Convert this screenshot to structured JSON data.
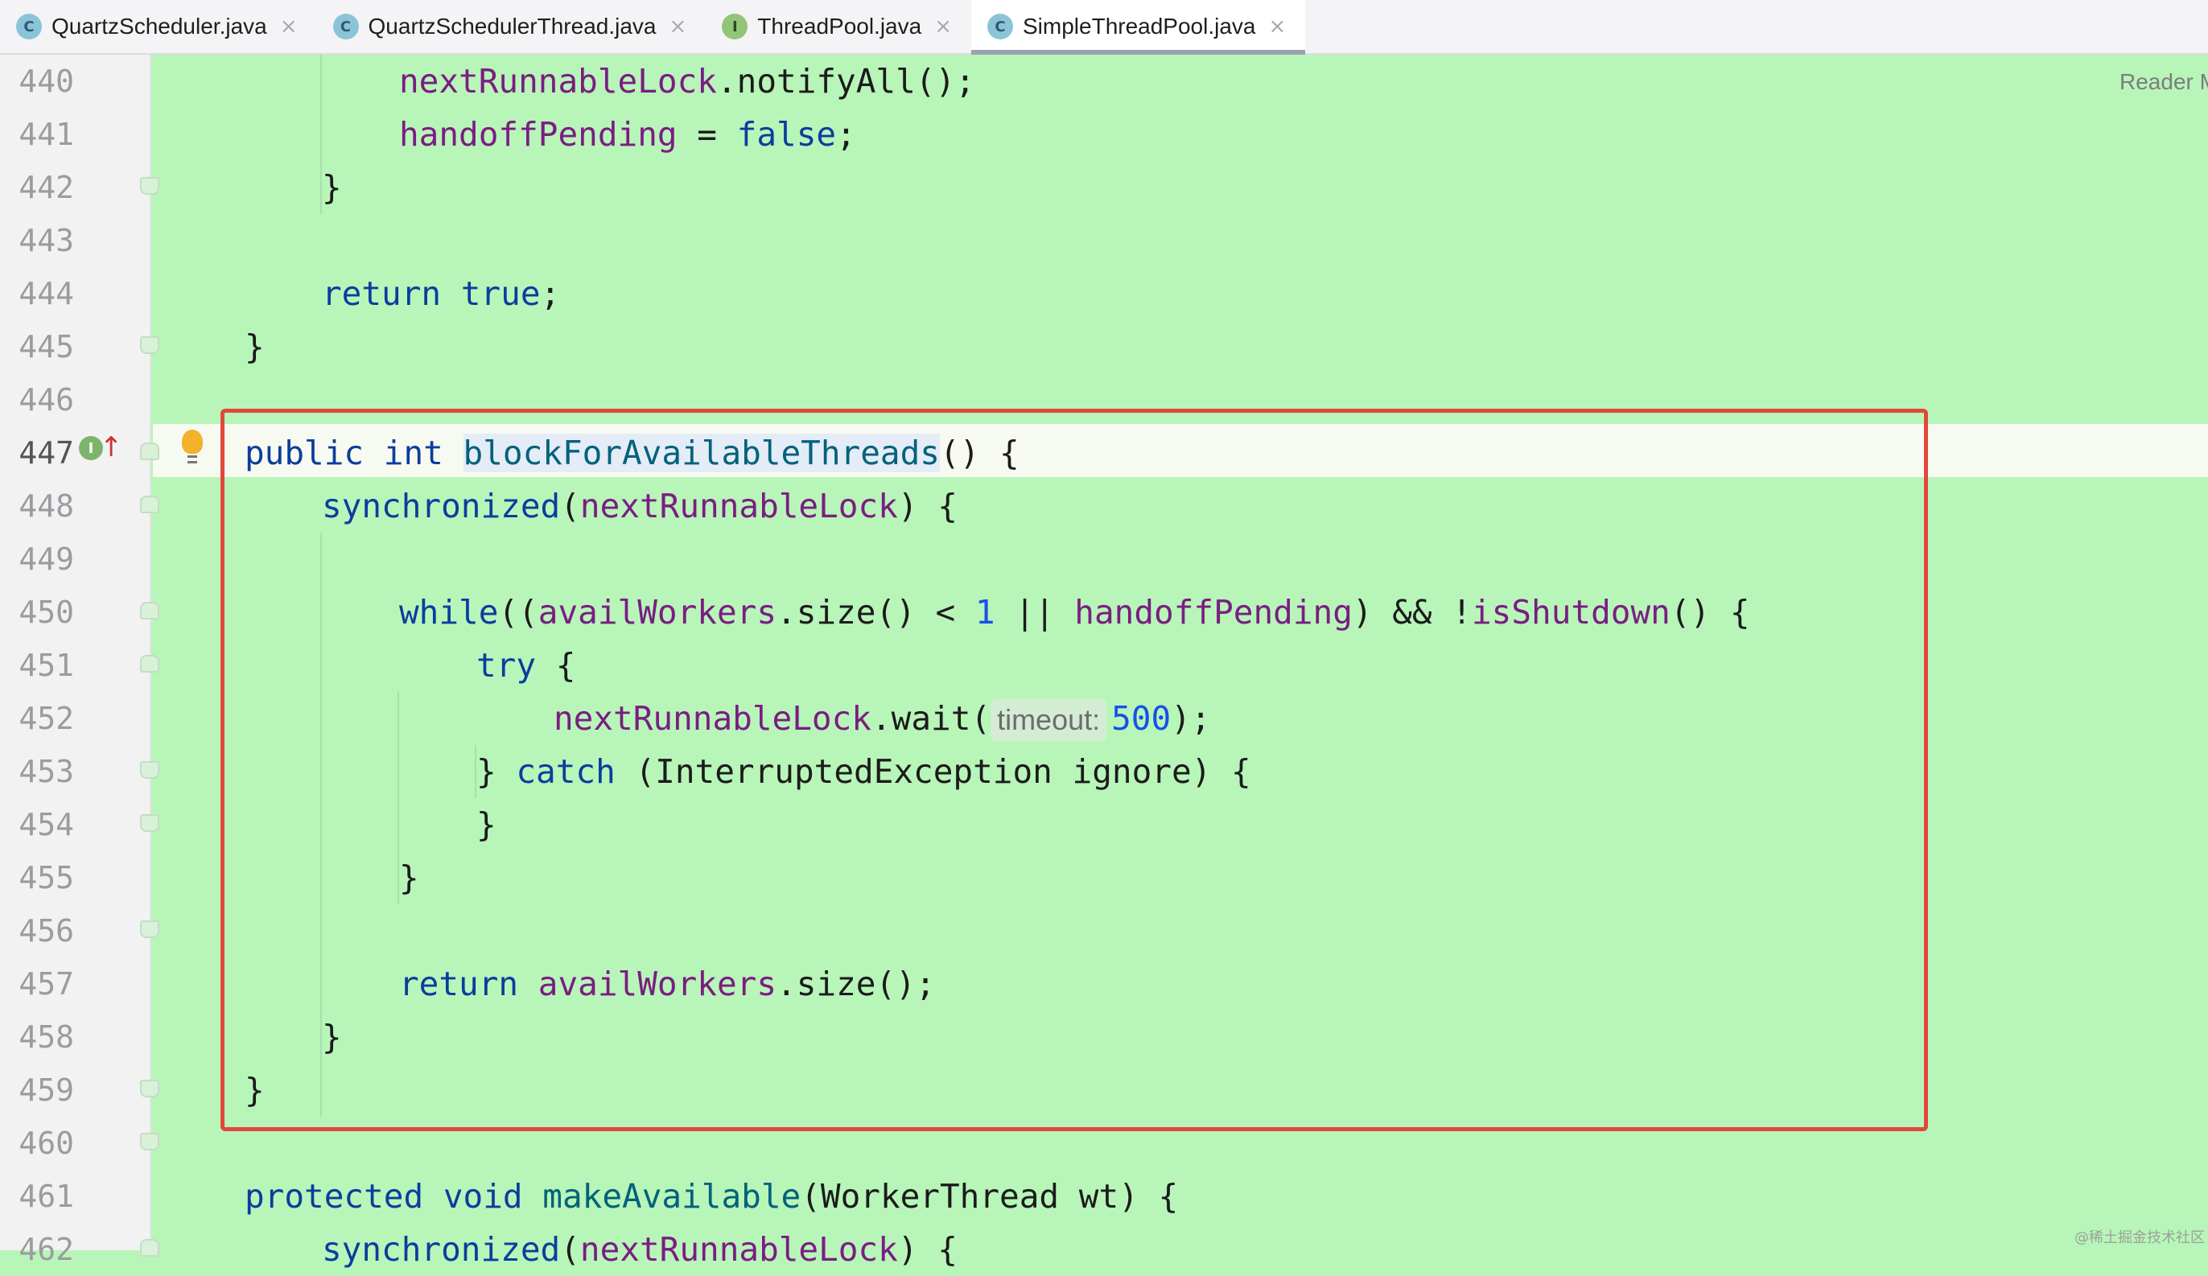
{
  "tabs": [
    {
      "label": "QuartzScheduler.java",
      "icon": "C",
      "icon_type": "class-icon"
    },
    {
      "label": "QuartzSchedulerThread.java",
      "icon": "C",
      "icon_type": "class-icon"
    },
    {
      "label": "ThreadPool.java",
      "icon": "I",
      "icon_type": "interface-icon"
    },
    {
      "label": "SimpleThreadPool.java",
      "icon": "C",
      "icon_type": "class-icon",
      "active": true
    }
  ],
  "tab_close_glyph": "×",
  "reader_mode_label": "Reader M",
  "gutter_icons": {
    "implements_marker": "I",
    "implements_arrow": "↑",
    "intention_bulb": "bulb-icon"
  },
  "line_numbers": [
    "440",
    "441",
    "442",
    "443",
    "444",
    "445",
    "446",
    "447",
    "448",
    "449",
    "450",
    "451",
    "452",
    "453",
    "454",
    "455",
    "456",
    "457",
    "458",
    "459",
    "460",
    "461",
    "462"
  ],
  "current_line": "447",
  "code": {
    "l440_field": "nextRunnableLock",
    "l440_rest": ".notifyAll();",
    "l441_field": "handoffPending",
    "l441_op": " = ",
    "l441_kw": "false",
    "l441_end": ";",
    "brace_close": "}",
    "l444_kw": "return",
    "l444_kw2": "true",
    "l444_end": ";",
    "l447_kw1": "public",
    "l447_kw2": "int",
    "l447_method": "blockForAvailableThreads",
    "l447_rest": "() {",
    "l448_kw": "synchronized",
    "l448_open": "(",
    "l448_field": "nextRunnableLock",
    "l448_rest": ") {",
    "l450_kw": "while",
    "l450_open": "((",
    "l450_f1": "availWorkers",
    "l450_mid": ".size() < ",
    "l450_num": "1",
    "l450_or": " || ",
    "l450_f2": "handoffPending",
    "l450_and": ") && !",
    "l450_m": "isShutdown",
    "l450_rest": "() {",
    "l451_kw": "try",
    "l451_rest": " {",
    "l452_field": "nextRunnableLock",
    "l452_call": ".wait(",
    "l452_hint": "timeout:",
    "l452_num": "500",
    "l452_rest": ");",
    "l453_open": "} ",
    "l453_kw": "catch",
    "l453_rest": " (InterruptedException ignore) {",
    "l457_kw": "return",
    "l457_field": "availWorkers",
    "l457_rest": ".size();",
    "l461_kw1": "protected",
    "l461_kw2": "void",
    "l461_method": "makeAvailable",
    "l461_rest": "(WorkerThread wt) {",
    "l462_kw": "synchronized",
    "l462_open": "(",
    "l462_field": "nextRunnableLock",
    "l462_rest": ") {"
  },
  "watermark": "@稀土掘金技术社区",
  "colors": {
    "editor_bg": "#b8f5b9",
    "highlight_box": "#e2473a",
    "keyword": "#0b3d9e",
    "field": "#7a1d82",
    "number": "#1750eb"
  }
}
